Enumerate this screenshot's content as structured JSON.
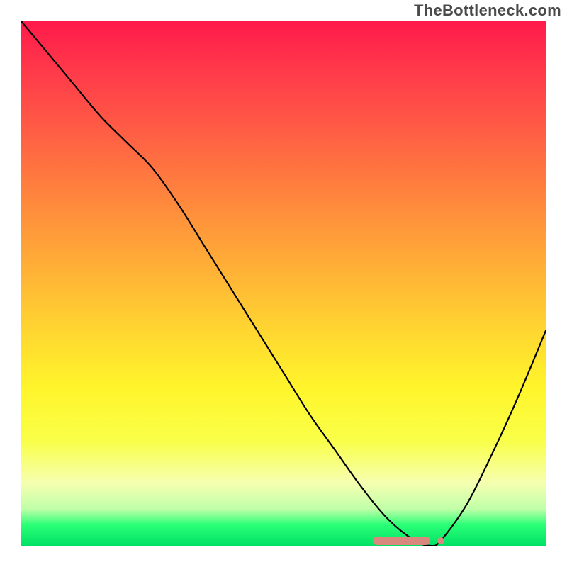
{
  "watermark": "TheBottleneck.com",
  "chart_data": {
    "type": "line",
    "title": "",
    "xlabel": "",
    "ylabel": "",
    "xlim": [
      0,
      100
    ],
    "ylim": [
      0,
      100
    ],
    "grid": false,
    "legend": null,
    "series": [
      {
        "name": "bottleneck-curve",
        "x": [
          0,
          5,
          10,
          15,
          20,
          25,
          30,
          35,
          40,
          45,
          50,
          55,
          60,
          65,
          70,
          75,
          78,
          80,
          85,
          90,
          95,
          100
        ],
        "y": [
          100,
          94,
          88,
          82,
          77,
          72,
          65,
          57,
          49,
          41,
          33,
          25,
          18,
          11,
          5,
          1,
          0,
          1,
          8,
          18,
          29,
          41
        ]
      }
    ],
    "marker": {
      "name": "optimal-range",
      "x_start": 67,
      "x_end": 78,
      "y": 1,
      "dot_x": 80,
      "dot_y": 1
    },
    "background_gradient": {
      "top": "#ff1a4b",
      "bottom": "#00e265"
    }
  }
}
